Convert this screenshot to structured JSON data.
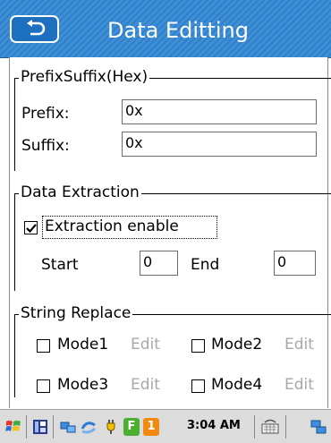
{
  "header": {
    "title": "Data Editting"
  },
  "prefix_suffix": {
    "group_title": "PrefixSuffix(Hex)",
    "prefix_label": "Prefix:",
    "prefix_value": "0x",
    "suffix_label": "Suffix:",
    "suffix_value": "0x"
  },
  "data_extraction": {
    "group_title": "Data Extraction",
    "enable_label": "Extraction enable",
    "enable_checked": true,
    "start_label": "Start",
    "start_value": "0",
    "end_label": "End",
    "end_value": "0"
  },
  "string_replace": {
    "group_title": "String Replace",
    "modes": [
      {
        "label": "Mode1",
        "edit_label": "Edit",
        "checked": false
      },
      {
        "label": "Mode2",
        "edit_label": "Edit",
        "checked": false
      },
      {
        "label": "Mode3",
        "edit_label": "Edit",
        "checked": false
      },
      {
        "label": "Mode4",
        "edit_label": "Edit",
        "checked": false
      }
    ]
  },
  "taskbar": {
    "clock": "3:04 AM",
    "badge_f": "F",
    "badge_1": "1",
    "icons": [
      "windows-start-icon",
      "app-icon",
      "network-icon",
      "sync-icon",
      "power-plug-icon",
      "keyboard-icon",
      "connect-icon"
    ]
  },
  "colors": {
    "title_bar": "#3f8fd6",
    "badge_green": "#4caf2f",
    "badge_orange": "#f08a10"
  }
}
